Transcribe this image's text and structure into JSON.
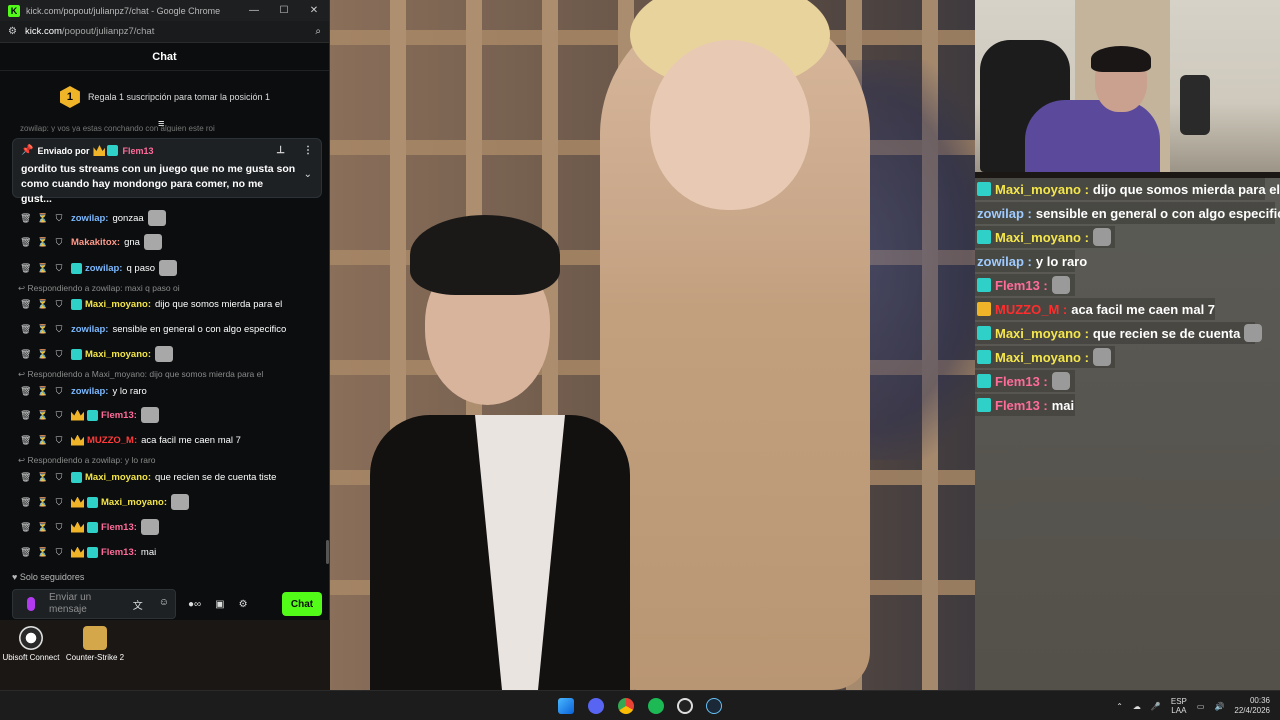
{
  "browser": {
    "title": "kick.com/popout/julianpz7/chat - Google Chrome",
    "domain": "kick.com",
    "path": "/popout/julianpz7/chat",
    "minimize": "—",
    "maximize": "☐",
    "close": "✕"
  },
  "chat": {
    "header": "Chat",
    "sub_gift": {
      "position_badge": "1",
      "text": "Regala 1 suscripción para tomar la posición 1"
    },
    "ghost_line": "zowilap: y vos ya estas conchando con alguien este roi",
    "pinned": {
      "label": "Enviado por",
      "sender": "Flem13",
      "text": "gordito tus streams con un juego que no me gusta son como cuando hay mondongo para comer, no me gust..."
    },
    "messages": [
      {
        "user": "zowilap",
        "text": "gonzaa",
        "color": "#7ab8ff"
      },
      {
        "user": "Makakitox",
        "text": "gna",
        "color": "#ff9a8a"
      },
      {
        "user": "zowilap",
        "text": "q paso",
        "color": "#7ab8ff"
      },
      {
        "user": "Maxi_moyano",
        "text": "dijo que somos mierda para el",
        "color": "#f4e64a"
      },
      {
        "user": "zowilap",
        "text": "sensible en general o con algo especifico",
        "color": "#7ab8ff"
      },
      {
        "user": "Maxi_moyano",
        "text": "",
        "color": "#f4e64a"
      },
      {
        "user": "zowilap",
        "text": "y lo raro",
        "color": "#7ab8ff"
      },
      {
        "user": "Flem13",
        "text": "",
        "color": "#ff6b9a"
      },
      {
        "user": "MUZZO_M",
        "text": "aca facil me caen mal 7",
        "color": "#ff3b3b"
      },
      {
        "user": "Maxi_moyano",
        "text": "que recien se de cuenta tiste",
        "color": "#f4e64a"
      },
      {
        "user": "Maxi_moyano",
        "text": "",
        "color": "#f4e64a"
      },
      {
        "user": "Flem13",
        "text": "",
        "color": "#ff6b9a"
      },
      {
        "user": "Flem13",
        "text": "mai",
        "color": "#ff6b9a"
      }
    ],
    "replies": [
      "Respondiendo a zowilap: maxi q paso oi",
      "Respondiendo a Maxi_moyano: dijo que somos mierda para el",
      "Respondiendo a zowilap: y lo raro"
    ],
    "followers_only": "Solo seguidores",
    "input_placeholder": "Enviar un mensaje",
    "send_button": "Chat"
  },
  "overlay_chat": [
    {
      "user": "Maxi_moyano",
      "sep": ":",
      "text": "dijo que somos mierda para el",
      "color": "#f4e64a"
    },
    {
      "user": "zowilap",
      "sep": ":",
      "text": "sensible en general o con algo especifico",
      "color": "#9ecbff"
    },
    {
      "user": "Maxi_moyano",
      "sep": ":",
      "text": "",
      "color": "#f4e64a"
    },
    {
      "user": "zowilap",
      "sep": ":",
      "text": "y lo raro",
      "color": "#9ecbff"
    },
    {
      "user": "Flem13",
      "sep": ":",
      "text": "",
      "color": "#ff6b9a"
    },
    {
      "user": "MUZZO_M",
      "sep": ":",
      "text": "aca facil me caen mal 7",
      "color": "#ff2d2d"
    },
    {
      "user": "Maxi_moyano",
      "sep": ":",
      "text": "que recien se de cuenta",
      "color": "#f4e64a"
    },
    {
      "user": "Maxi_moyano",
      "sep": ":",
      "text": "",
      "color": "#f4e64a"
    },
    {
      "user": "Flem13",
      "sep": ":",
      "text": "",
      "color": "#ff6b9a"
    },
    {
      "user": "Flem13",
      "sep": ":",
      "text": "mai",
      "color": "#ff6b9a"
    }
  ],
  "desktop_icons": [
    "Ubisoft Connect",
    "Counter-Strike 2"
  ],
  "taskbar": {
    "lang_top": "ESP",
    "lang_bottom": "LAA",
    "time": "00:36",
    "date": "22/4/2026",
    "apps": [
      "windows-start-icon",
      "discord-icon",
      "chrome-icon",
      "spotify-icon",
      "github-icon",
      "steam-icon"
    ]
  },
  "colors": {
    "kick_green": "#53fc18",
    "accent_gold": "#f0b429"
  }
}
